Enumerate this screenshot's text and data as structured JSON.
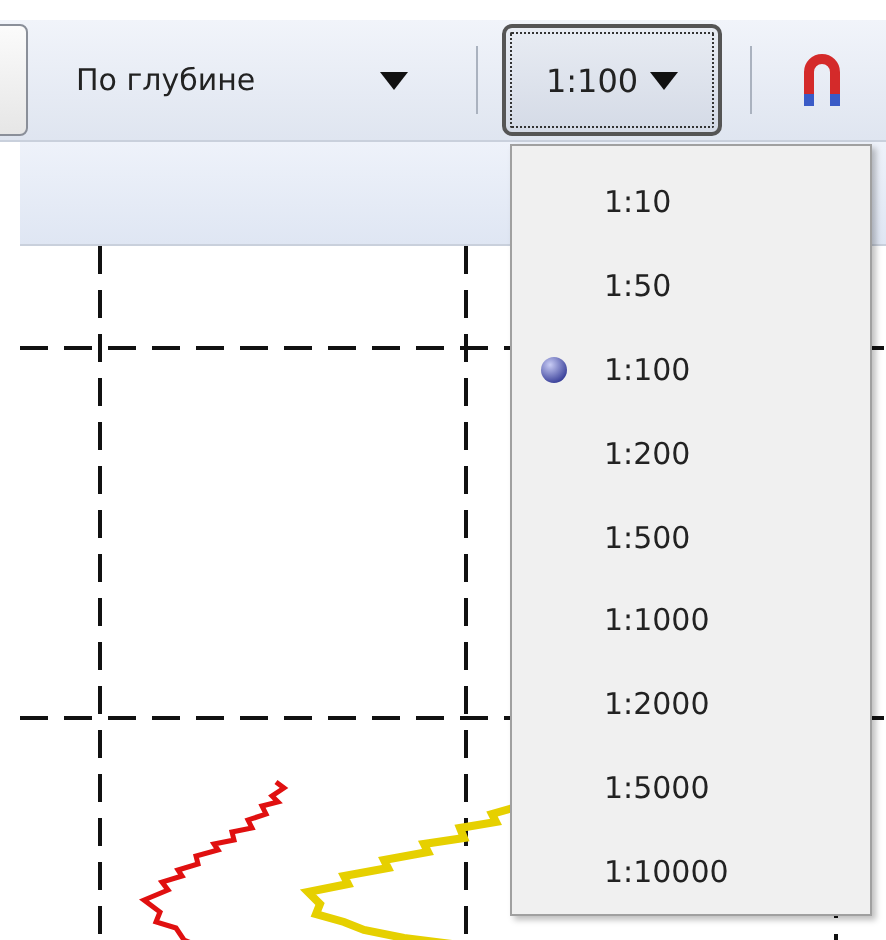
{
  "toolbar": {
    "mode_dropdown": {
      "value": "По глубине"
    },
    "scale_dropdown": {
      "value": "1:100",
      "expanded": true
    }
  },
  "scale_menu": {
    "items": [
      {
        "label": "1:10",
        "selected": false
      },
      {
        "label": "1:50",
        "selected": false
      },
      {
        "label": "1:100",
        "selected": true
      },
      {
        "label": "1:200",
        "selected": false
      },
      {
        "label": "1:500",
        "selected": false
      },
      {
        "label": "1:1000",
        "selected": false
      },
      {
        "label": "1:2000",
        "selected": false
      },
      {
        "label": "1:5000",
        "selected": false
      },
      {
        "label": "1:10000",
        "selected": false
      }
    ]
  }
}
